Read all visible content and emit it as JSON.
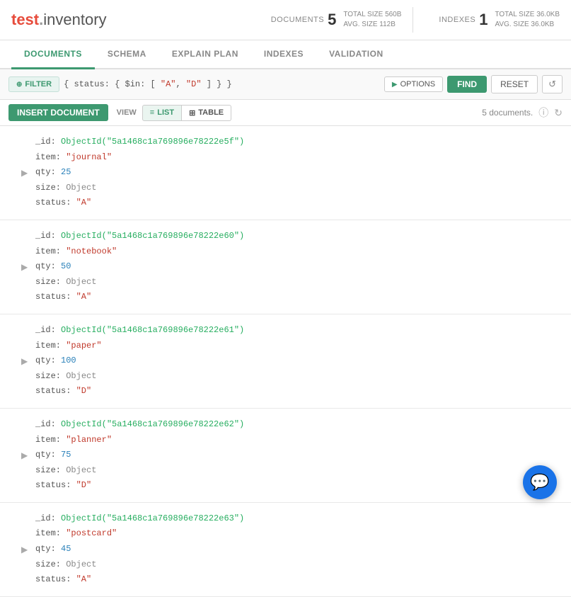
{
  "app": {
    "logo_test": "test",
    "logo_dot": ".",
    "logo_inventory": "inventory"
  },
  "header": {
    "documents_label": "DOCUMENTS",
    "documents_count": "5",
    "total_size_label": "TOTAL SIZE",
    "documents_total_size": "560B",
    "avg_size_label": "AVG. SIZE",
    "documents_avg_size": "112B",
    "indexes_label": "INDEXES",
    "indexes_count": "1",
    "indexes_total_size": "36.0KB",
    "indexes_avg_size": "36.0KB"
  },
  "tabs": [
    {
      "id": "documents",
      "label": "DOCUMENTS",
      "active": true
    },
    {
      "id": "schema",
      "label": "SCHEMA",
      "active": false
    },
    {
      "id": "explain-plan",
      "label": "EXPLAIN PLAN",
      "active": false
    },
    {
      "id": "indexes",
      "label": "INDEXES",
      "active": false
    },
    {
      "id": "validation",
      "label": "VALIDATION",
      "active": false
    }
  ],
  "filter": {
    "button_label": "FILTER",
    "query_text": "{ status: { $in: [ \"A\", \"D\" ] } }",
    "options_label": "OPTIONS",
    "find_label": "FIND",
    "reset_label": "RESET"
  },
  "toolbar": {
    "insert_label": "INSERT DOCUMENT",
    "view_label": "VIEW",
    "list_label": "LIST",
    "table_label": "TABLE",
    "doc_count": "5 documents."
  },
  "documents": [
    {
      "id": "ObjectId(\"5a1468c1a769896e78222e5f\")",
      "item": "\"journal\"",
      "qty": "25",
      "size": "Object",
      "status": "\"A\""
    },
    {
      "id": "ObjectId(\"5a1468c1a769896e78222e60\")",
      "item": "\"notebook\"",
      "qty": "50",
      "size": "Object",
      "status": "\"A\""
    },
    {
      "id": "ObjectId(\"5a1468c1a769896e78222e61\")",
      "item": "\"paper\"",
      "qty": "100",
      "size": "Object",
      "status": "\"D\""
    },
    {
      "id": "ObjectId(\"5a1468c1a769896e78222e62\")",
      "item": "\"planner\"",
      "qty": "75",
      "size": "Object",
      "status": "\"D\""
    },
    {
      "id": "ObjectId(\"5a1468c1a769896e78222e63\")",
      "item": "\"postcard\"",
      "qty": "45",
      "size": "Object",
      "status": "\"A\""
    }
  ]
}
